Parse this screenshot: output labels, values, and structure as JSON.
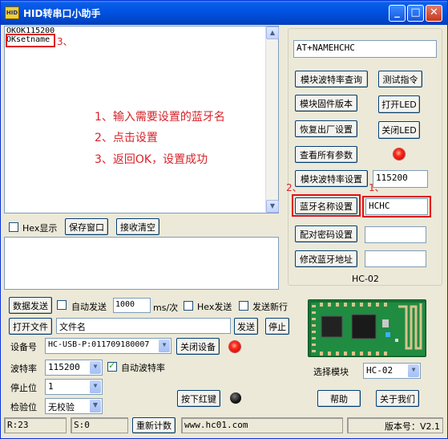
{
  "window": {
    "title": "HID转串口小助手",
    "icon_text": "HID",
    "btn_minimize": "_",
    "btn_maximize": "□",
    "btn_close": "✕"
  },
  "receive": {
    "lines": [
      "OKOK115200",
      "OKsetname"
    ]
  },
  "annotations": {
    "step1": "1、输入需要设置的蓝牙名",
    "step2": "2、点击设置",
    "step3": "3、返回OK，设置成功",
    "mark1": "1、",
    "mark2": "2、",
    "mark3": "3、"
  },
  "recv_toolbar": {
    "hex_display": "Hex显示",
    "save_window": "保存窗口",
    "clear_receive": "接收清空"
  },
  "right_panel": {
    "at_command": "AT+NAMEHCHC",
    "query_baud": "模块波特率查询",
    "test_command": "测试指令",
    "firmware_version": "模块固件版本",
    "led_on": "打开LED",
    "factory_reset": "恢复出厂设置",
    "led_off": "关闭LED",
    "view_params": "查看所有参数",
    "set_baud": "模块波特率设置",
    "baud_value": "115200",
    "set_bt_name": "蓝牙名称设置",
    "bt_name_value": "HCHC",
    "pair_password": "配对密码设置",
    "pair_password_value": "",
    "modify_bt_address": "修改蓝牙地址",
    "bt_address_value": "",
    "model_label": "HC-02"
  },
  "send": {
    "data_send": "数据发送",
    "auto_send": "自动发送",
    "interval": "1000",
    "interval_unit": "ms/次",
    "hex_send": "Hex发送",
    "send_newline": "发送新行",
    "open_file": "打开文件",
    "file_name": "文件名",
    "send": "发送",
    "stop": "停止"
  },
  "device": {
    "device_label": "设备号",
    "device_value": "HC-USB-P:011709180007",
    "close_device": "关闭设备",
    "baud_label": "波特率",
    "baud_value": "115200",
    "auto_baud": "自动波特率",
    "stop_bits_label": "停止位",
    "stop_bits_value": "1",
    "parity_label": "检验位",
    "parity_value": "无校验",
    "red_key": "按下红键",
    "select_module": "选择模块",
    "module_value": "HC-02",
    "help": "帮助",
    "about": "关于我们"
  },
  "status": {
    "rx": "R:23",
    "tx": "S:0",
    "reset_count": "重新计数",
    "website": "www.hc01.com",
    "version": "版本号：V2.1"
  },
  "colors": {
    "annotation_red": "#d8232a",
    "pcb_green": "#1d7a3a",
    "title_blue": "#0054e3"
  }
}
